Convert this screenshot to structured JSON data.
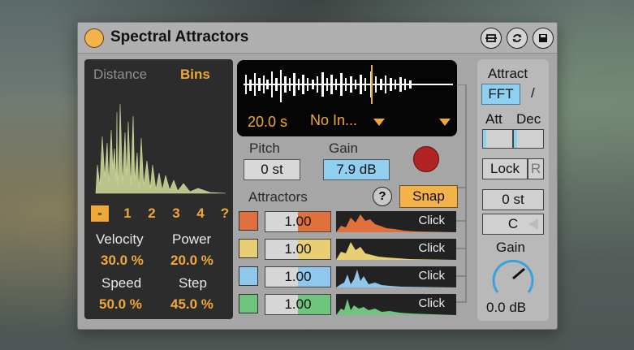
{
  "device": {
    "title": "Spectral Attractors",
    "buttons": [
      "fold-icon",
      "swap-icon",
      "save-icon"
    ]
  },
  "left_panel": {
    "tab_distance": "Distance",
    "tab_bins": "Bins",
    "mode_buttons": [
      "-",
      "1",
      "2",
      "3",
      "4",
      "?"
    ],
    "selected_mode": "-",
    "velocity_label": "Velocity",
    "velocity_value": "30.0 %",
    "power_label": "Power",
    "power_value": "20.0 %",
    "speed_label": "Speed",
    "speed_value": "50.0 %",
    "step_label": "Step",
    "step_value": "45.0 %"
  },
  "sample": {
    "duration": "20.0 s",
    "name": "No In...",
    "dropdown_icon": "triangle-down-icon"
  },
  "pitch": {
    "label": "Pitch",
    "value": "0 st"
  },
  "gain": {
    "label": "Gain",
    "value": "7.9 dB"
  },
  "attractors": {
    "label": "Attractors",
    "help": "?",
    "snap": "Snap",
    "rows": [
      {
        "value": "1.00",
        "color": "#e0703c",
        "action": "Click"
      },
      {
        "value": "1.00",
        "color": "#e9cf73",
        "action": "Click"
      },
      {
        "value": "1.00",
        "color": "#8fc8ec",
        "action": "Click"
      },
      {
        "value": "1.00",
        "color": "#6fc47f",
        "action": "Click"
      }
    ]
  },
  "right_panel": {
    "attract_label": "Attract",
    "fft_label": "FFT",
    "slash": "/",
    "att_label": "Att",
    "dec_label": "Dec",
    "lock_label": "Lock",
    "r_label": "R",
    "transpose_value": "0 st",
    "key_value": "C",
    "gain_label": "Gain",
    "gain_value": "0.0 dB"
  },
  "colors": {
    "accent": "#f0a83a",
    "fft": "#8fd0f0",
    "record": "#b22424"
  }
}
